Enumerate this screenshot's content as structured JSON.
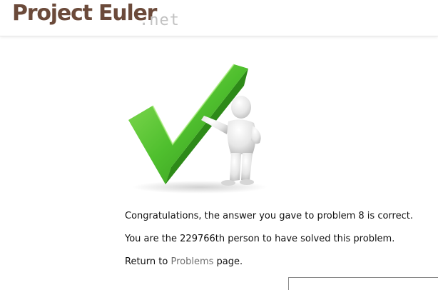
{
  "header": {
    "logo_main": "Project Euler",
    "logo_suffix": ".net"
  },
  "illustration": {
    "icon": "checkmark-with-figure-icon",
    "check_color": "#4fb832",
    "figure_color": "#eeeeee"
  },
  "result": {
    "congrats_text": "Congratulations, the answer you gave to problem 8 is correct.",
    "solvers_text": "You are the 229766th person to have solved this problem.",
    "return_prefix": "Return to ",
    "return_link": "Problems",
    "return_suffix": " page."
  },
  "colors": {
    "logo": "#6b4a3a",
    "logo_suffix": "#c2c2c2",
    "link": "#6f6f6f"
  }
}
